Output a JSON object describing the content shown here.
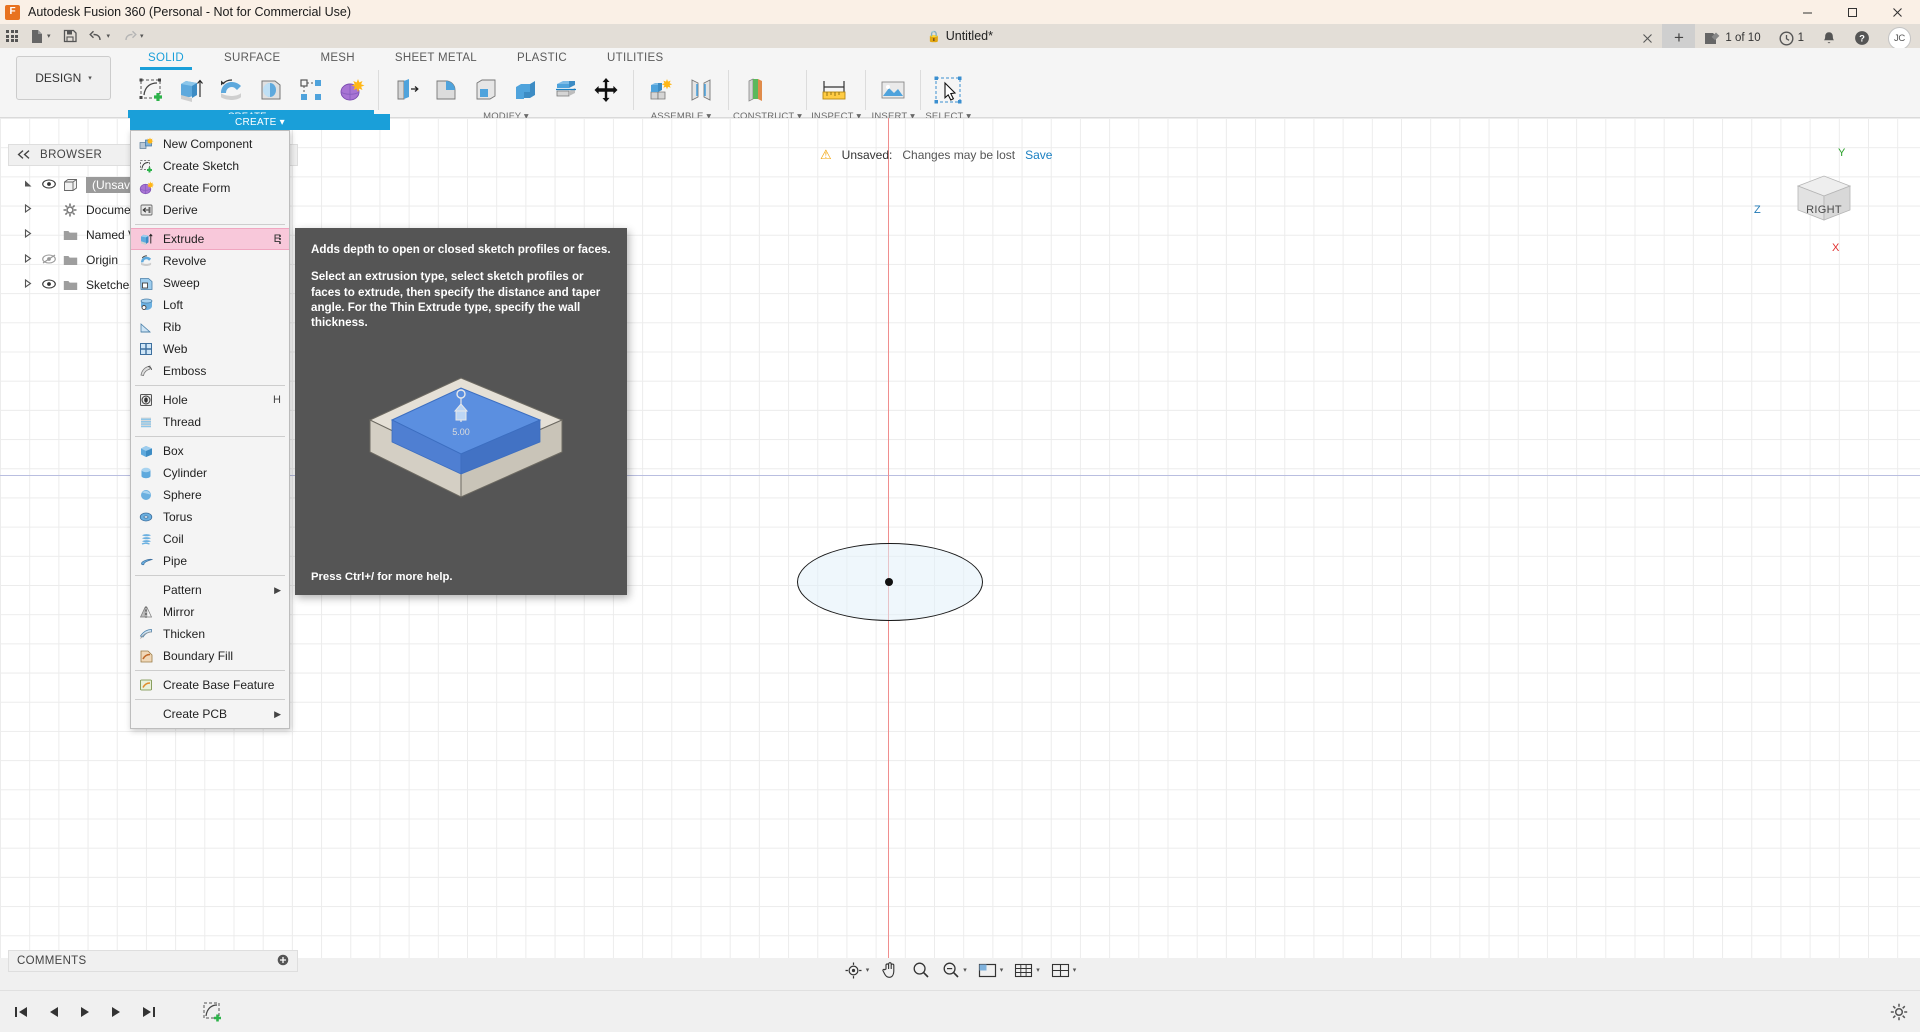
{
  "window": {
    "title": "Autodesk Fusion 360 (Personal - Not for Commercial Use)",
    "logo_icon": "fusion-logo-icon",
    "minimize_label": "─",
    "maximize_label": "□",
    "close_label": "✕"
  },
  "quick_access": {
    "app_grid_icon": "app-grid-icon",
    "new_file_icon": "new-file-icon",
    "save_icon": "save-icon",
    "undo_icon": "undo-icon",
    "redo_icon": "redo-icon",
    "caret": "▾"
  },
  "document_tab": {
    "lock_icon": "lock-icon",
    "title": "Untitled*",
    "close_label": "✕",
    "new_tab_label": "+"
  },
  "top_right": {
    "extensions_icon": "extensions-icon",
    "extensions_label": "1 of 10",
    "jobs_icon": "job-status-icon",
    "jobs_label": "1",
    "notifications_icon": "bell-icon",
    "help_icon": "help-icon",
    "avatar_initials": "JC"
  },
  "workspace": {
    "selector_label": "DESIGN",
    "selector_caret": "▾"
  },
  "ribbon": {
    "tabs": [
      {
        "label": "SOLID",
        "active": true
      },
      {
        "label": "SURFACE",
        "active": false
      },
      {
        "label": "MESH",
        "active": false
      },
      {
        "label": "SHEET METAL",
        "active": false
      },
      {
        "label": "PLASTIC",
        "active": false
      },
      {
        "label": "UTILITIES",
        "active": false
      }
    ],
    "panels": [
      {
        "label": "CREATE ▾",
        "highlighted": true
      },
      {
        "label": "MODIFY ▾",
        "highlighted": false
      },
      {
        "label": "ASSEMBLE ▾",
        "highlighted": false
      },
      {
        "label": "CONSTRUCT ▾",
        "highlighted": false
      },
      {
        "label": "INSPECT ▾",
        "highlighted": false
      },
      {
        "label": "INSERT ▾",
        "highlighted": false
      },
      {
        "label": "SELECT ▾",
        "highlighted": false
      }
    ]
  },
  "browser": {
    "collapse_icon": "collapse-left-icon",
    "title": "BROWSER",
    "rows": [
      {
        "name": "(Unsaved)",
        "icon": "component-icon",
        "selected": true,
        "has_eye": true,
        "has_arrow": true
      },
      {
        "name": "Document Settings",
        "icon": "gear-icon",
        "selected": false,
        "has_eye": false,
        "has_arrow": true
      },
      {
        "name": "Named Views",
        "icon": "folder-icon",
        "selected": false,
        "has_eye": false,
        "has_arrow": true
      },
      {
        "name": "Origin",
        "icon": "folder-icon",
        "selected": false,
        "has_eye": true,
        "has_arrow": true
      },
      {
        "name": "Sketches",
        "icon": "folder-icon",
        "selected": false,
        "has_eye": true,
        "has_arrow": true
      }
    ]
  },
  "toast": {
    "warning_icon": "warning-icon",
    "label": "Unsaved:",
    "message": "Changes may be lost",
    "action": "Save"
  },
  "view_cube": {
    "face_label": "RIGHT",
    "axis_z": "Z",
    "axis_y": "Y",
    "axis_x": "X",
    "home_icon": "home-icon"
  },
  "create_menu": {
    "header": "CREATE ▾",
    "items": [
      {
        "label": "New Component",
        "icon": "new-component-icon",
        "shortcut": "",
        "highlighted": false,
        "separator_after": false,
        "submenu": false
      },
      {
        "label": "Create Sketch",
        "icon": "create-sketch-icon",
        "shortcut": "",
        "highlighted": false,
        "separator_after": false,
        "submenu": false
      },
      {
        "label": "Create Form",
        "icon": "create-form-icon",
        "shortcut": "",
        "highlighted": false,
        "separator_after": false,
        "submenu": false
      },
      {
        "label": "Derive",
        "icon": "derive-icon",
        "shortcut": "",
        "highlighted": false,
        "separator_after": true,
        "submenu": false
      },
      {
        "label": "Extrude",
        "icon": "extrude-icon",
        "shortcut": "E",
        "highlighted": true,
        "separator_after": false,
        "submenu": false
      },
      {
        "label": "Revolve",
        "icon": "revolve-icon",
        "shortcut": "",
        "highlighted": false,
        "separator_after": false,
        "submenu": false
      },
      {
        "label": "Sweep",
        "icon": "sweep-icon",
        "shortcut": "",
        "highlighted": false,
        "separator_after": false,
        "submenu": false
      },
      {
        "label": "Loft",
        "icon": "loft-icon",
        "shortcut": "",
        "highlighted": false,
        "separator_after": false,
        "submenu": false
      },
      {
        "label": "Rib",
        "icon": "rib-icon",
        "shortcut": "",
        "highlighted": false,
        "separator_after": false,
        "submenu": false
      },
      {
        "label": "Web",
        "icon": "web-icon",
        "shortcut": "",
        "highlighted": false,
        "separator_after": false,
        "submenu": false
      },
      {
        "label": "Emboss",
        "icon": "emboss-icon",
        "shortcut": "",
        "highlighted": false,
        "separator_after": true,
        "submenu": false
      },
      {
        "label": "Hole",
        "icon": "hole-icon",
        "shortcut": "H",
        "highlighted": false,
        "separator_after": false,
        "submenu": false
      },
      {
        "label": "Thread",
        "icon": "thread-icon",
        "shortcut": "",
        "highlighted": false,
        "separator_after": true,
        "submenu": false
      },
      {
        "label": "Box",
        "icon": "box-icon",
        "shortcut": "",
        "highlighted": false,
        "separator_after": false,
        "submenu": false
      },
      {
        "label": "Cylinder",
        "icon": "cylinder-icon",
        "shortcut": "",
        "highlighted": false,
        "separator_after": false,
        "submenu": false
      },
      {
        "label": "Sphere",
        "icon": "sphere-icon",
        "shortcut": "",
        "highlighted": false,
        "separator_after": false,
        "submenu": false
      },
      {
        "label": "Torus",
        "icon": "torus-icon",
        "shortcut": "",
        "highlighted": false,
        "separator_after": false,
        "submenu": false
      },
      {
        "label": "Coil",
        "icon": "coil-icon",
        "shortcut": "",
        "highlighted": false,
        "separator_after": false,
        "submenu": false
      },
      {
        "label": "Pipe",
        "icon": "pipe-icon",
        "shortcut": "",
        "highlighted": false,
        "separator_after": true,
        "submenu": false
      },
      {
        "label": "Pattern",
        "icon": "",
        "shortcut": "",
        "highlighted": false,
        "separator_after": false,
        "submenu": true
      },
      {
        "label": "Mirror",
        "icon": "mirror-icon",
        "shortcut": "",
        "highlighted": false,
        "separator_after": false,
        "submenu": false
      },
      {
        "label": "Thicken",
        "icon": "thicken-icon",
        "shortcut": "",
        "highlighted": false,
        "separator_after": false,
        "submenu": false
      },
      {
        "label": "Boundary Fill",
        "icon": "boundary-fill-icon",
        "shortcut": "",
        "highlighted": false,
        "separator_after": true,
        "submenu": false
      },
      {
        "label": "Create Base Feature",
        "icon": "create-base-feature-icon",
        "shortcut": "",
        "highlighted": false,
        "separator_after": true,
        "submenu": false
      },
      {
        "label": "Create PCB",
        "icon": "",
        "shortcut": "",
        "highlighted": false,
        "separator_after": false,
        "submenu": true
      }
    ],
    "submenu_arrow": "▶"
  },
  "tooltip": {
    "paragraph1": "Adds depth to open or closed sketch profiles or faces.",
    "paragraph2": "Select an extrusion type, select sketch profiles or faces to extrude, then specify the distance and taper angle. For the Thin Extrude type, specify the wall thickness.",
    "footer": "Press Ctrl+/ for more help.",
    "image_caption": "5.00"
  },
  "comments": {
    "title": "COMMENTS",
    "add_icon": "add-comment-icon"
  },
  "nav_bar": {
    "buttons": [
      {
        "icon": "orbit-icon",
        "caret": "▾"
      },
      {
        "icon": "pan-icon",
        "caret": ""
      },
      {
        "icon": "zoom-icon",
        "caret": ""
      },
      {
        "icon": "zoom-window-icon",
        "caret": "▾"
      },
      {
        "icon": "display-settings-icon",
        "caret": "▾"
      },
      {
        "icon": "grid-snap-icon",
        "caret": "▾"
      },
      {
        "icon": "viewports-icon",
        "caret": "▾"
      }
    ]
  },
  "timeline": {
    "buttons": [
      {
        "icon": "go-to-beginning-icon"
      },
      {
        "icon": "step-back-icon"
      },
      {
        "icon": "play-icon"
      },
      {
        "icon": "step-forward-icon"
      },
      {
        "icon": "go-to-end-icon"
      }
    ],
    "feature_icon": "sketch-feature-icon",
    "settings_icon": "timeline-settings-icon"
  },
  "colors": {
    "accent_blue": "#1a9fd9",
    "highlight_pink": "#f8c8da",
    "titlebar_bg": "#faf0e6",
    "tooltip_bg": "#555555",
    "axis_red": "#f08e8e",
    "axis_blue": "#b9bee0"
  }
}
